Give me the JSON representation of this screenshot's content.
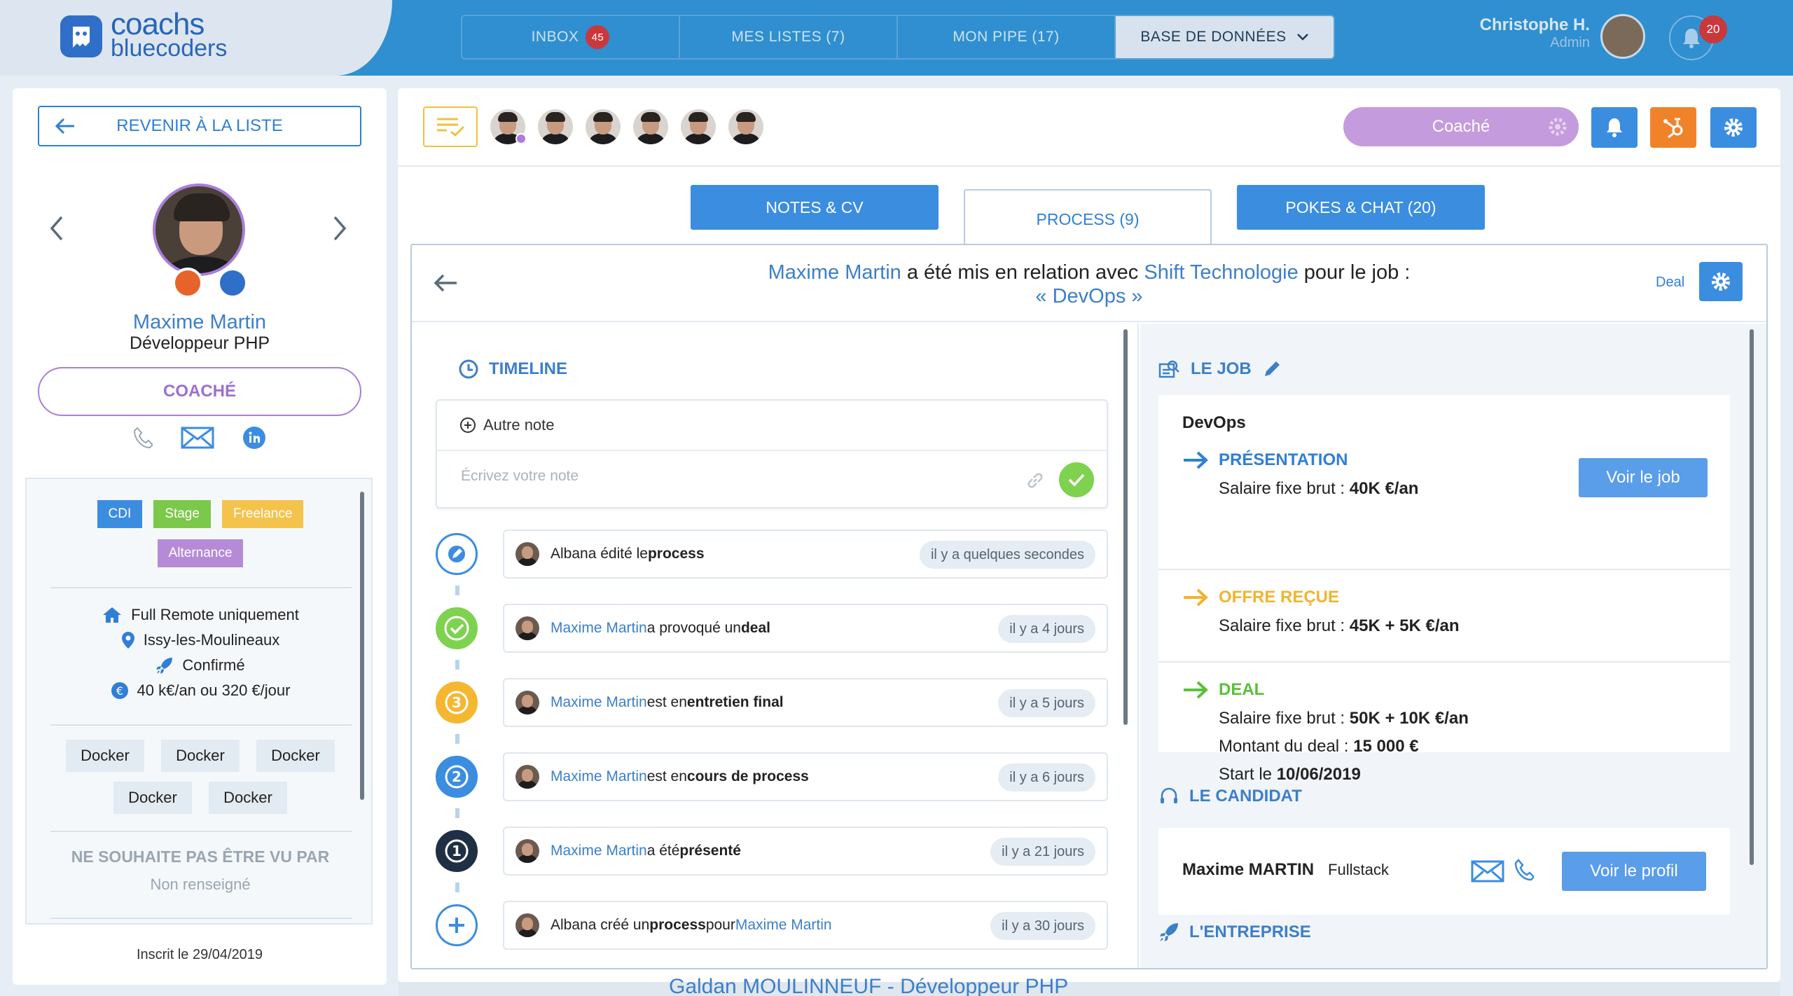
{
  "brand": {
    "line1": "coachs",
    "line2": "bluecoders"
  },
  "nav": {
    "tabs": [
      {
        "label": "INBOX",
        "badge": "45"
      },
      {
        "label": "MES LISTES (7)"
      },
      {
        "label": "MON PIPE (17)"
      },
      {
        "label": "BASE DE DONNÉES"
      }
    ]
  },
  "user": {
    "name": "Christophe H.",
    "role": "Admin",
    "notifications": "20"
  },
  "profile": {
    "back_label": "REVENIR À LA LISTE",
    "name": "Maxime Martin",
    "title": "Développeur PHP",
    "status": "COACHÉ",
    "contract_types": [
      "CDI",
      "Stage",
      "Freelance",
      "Alternance"
    ],
    "info": [
      "Full Remote uniquement",
      "Issy-les-Moulineaux",
      "Confirmé",
      "40 k€/an ou 320 €/jour"
    ],
    "skills": [
      "Docker",
      "Docker",
      "Docker",
      "Docker",
      "Docker"
    ],
    "not_seen_title": "NE SOUHAITE PAS ÊTRE VU PAR",
    "not_seen_value": "Non renseigné",
    "registered": "Inscrit le 29/04/2019"
  },
  "toolbar": {
    "coache_label": "Coaché"
  },
  "tabs": [
    "NOTES & CV",
    "PROCESS (9)",
    "POKES & CHAT (20)"
  ],
  "process": {
    "candidate": "Maxime Martin",
    "mid": " a été mis en relation avec ",
    "company": "Shift Technologie",
    "tail": " pour le job :",
    "job": "« DevOps »",
    "deal_label": "Deal"
  },
  "timeline": {
    "title": "TIMELINE",
    "other_note": "Autre note",
    "note_placeholder": "Écrivez votre note",
    "events": [
      {
        "icon": "pencil",
        "who": "Alban",
        "text1": " a édité le ",
        "bold": "process",
        "time": "il y a quelques secondes"
      },
      {
        "icon": "deal",
        "who": "Maxime Martin",
        "text1": " a provoqué un ",
        "bold": "deal",
        "time": "il y a 4 jours"
      },
      {
        "icon": "3",
        "who": "Maxime Martin",
        "text1": " est en ",
        "bold": "entretien final",
        "time": "il y a 5 jours"
      },
      {
        "icon": "2",
        "who": "Maxime Martin",
        "text1": " est en ",
        "bold": "cours de process",
        "time": "il y a 6 jours"
      },
      {
        "icon": "1",
        "who": "Maxime Martin",
        "text1": " a été ",
        "bold": "présenté",
        "time": "il y a 21 jours"
      },
      {
        "icon": "plus",
        "who": "Alban",
        "text1": " a créé un ",
        "bold": "process",
        "text2": " pour ",
        "link2": "Maxime Martin",
        "time": "il y a 30 jours"
      }
    ]
  },
  "job": {
    "section_title": "LE JOB",
    "name": "DevOps",
    "presentation_title": "PRÉSENTATION",
    "presentation_salary_label": "Salaire fixe brut : ",
    "presentation_salary": "40K €/an",
    "voir_job": "Voir le job",
    "offre_title": "OFFRE REÇUE",
    "offre_salary_label": "Salaire fixe brut : ",
    "offre_salary": "45K + 5K €/an",
    "deal_title": "DEAL",
    "deal_salary_label": "Salaire fixe brut : ",
    "deal_salary": "50K + 10K €/an",
    "deal_amount_label": "Montant du deal : ",
    "deal_amount": "15 000 €",
    "deal_start_label": "Start le ",
    "deal_start": "10/06/2019"
  },
  "candidate": {
    "section_title": "LE CANDIDAT",
    "name": "Maxime MARTIN",
    "type": "Fullstack",
    "voir_profil": "Voir le profil"
  },
  "company": {
    "section_title": "L'ENTREPRISE"
  },
  "below": {
    "text": "Galdan MOULINNEUF - Développeur PHP"
  },
  "colors": {
    "primary": "#3b8de0",
    "accent_purple": "#a97ed8",
    "orange": "#f0832a",
    "green": "#7ed24f",
    "yellow": "#f0c141",
    "navy": "#1f2f44"
  }
}
